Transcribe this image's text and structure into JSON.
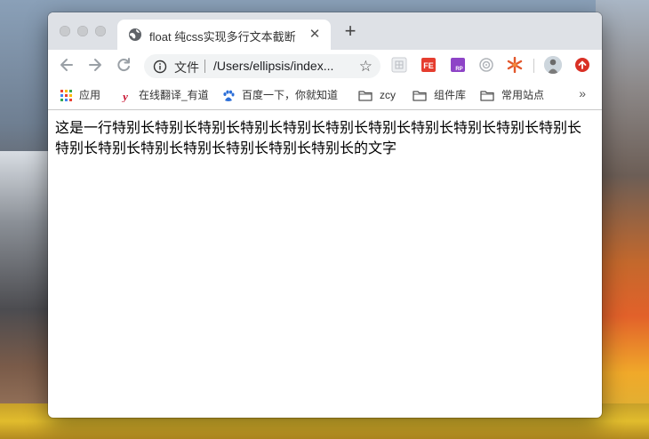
{
  "tab": {
    "title": "float 纯css实现多行文本截断",
    "close_glyph": "✕"
  },
  "new_tab_glyph": "+",
  "omnibox": {
    "scheme": "文件",
    "url": "/Users/ellipsis/index..."
  },
  "bookmarks": [
    {
      "label": "应用",
      "icon": "apps-grid-icon"
    },
    {
      "label": "在线翻译_有道",
      "icon": "youdao-icon"
    },
    {
      "label": "百度一下，你就知道",
      "icon": "baidu-paw-icon"
    },
    {
      "label": "zcy",
      "icon": "folder-icon"
    },
    {
      "label": "组件库",
      "icon": "folder-icon"
    },
    {
      "label": "常用站点",
      "icon": "folder-icon"
    }
  ],
  "bookmarks_more": "»",
  "content": {
    "text": "这是一行特别长特别长特别长特别长特别长特别长特别长特别长特别长特别长特别长特别长特别长特别长特别长特别长特别长特别长的文字"
  }
}
